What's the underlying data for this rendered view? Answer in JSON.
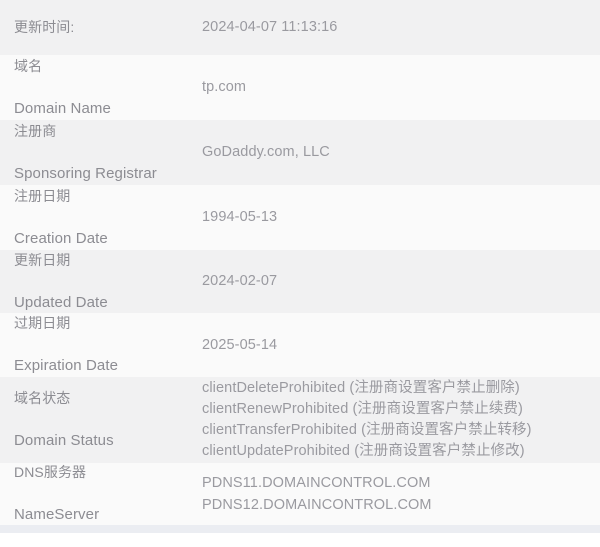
{
  "table": {
    "rows": [
      {
        "label_cn": "更新时间:",
        "label_en": "",
        "value": "2024-04-07 11:13:16",
        "name": "update-time"
      },
      {
        "label_cn": "域名",
        "label_en": "Domain Name",
        "value": "tp.com",
        "name": "domain-name"
      },
      {
        "label_cn": "注册商",
        "label_en": "Sponsoring Registrar",
        "value": "GoDaddy.com, LLC",
        "name": "sponsoring-registrar"
      },
      {
        "label_cn": "注册日期",
        "label_en": "Creation Date",
        "value": "1994-05-13",
        "name": "creation-date"
      },
      {
        "label_cn": "更新日期",
        "label_en": "Updated Date",
        "value": "2024-02-07",
        "name": "updated-date"
      },
      {
        "label_cn": "过期日期",
        "label_en": "Expiration Date",
        "value": "2025-05-14",
        "name": "expiration-date"
      },
      {
        "label_cn": "域名状态",
        "label_en": "Domain Status",
        "value": "clientDeleteProhibited (注册商设置客户禁止删除)\nclientRenewProhibited (注册商设置客户禁止续费)\nclientTransferProhibited (注册商设置客户禁止转移)\nclientUpdateProhibited (注册商设置客户禁止修改)",
        "name": "domain-status"
      },
      {
        "label_cn": "DNS服务器",
        "label_en": "NameServer",
        "value": "PDNS11.DOMAINCONTROL.COM\nPDNS12.DOMAINCONTROL.COM",
        "name": "name-server"
      }
    ]
  },
  "colors": {
    "stripe_light": "#f1f1f2",
    "stripe_lighter": "#fafafa",
    "label_text": "#8c8c92",
    "value_text": "#9a9aa0",
    "bottom_strip": "#ebedf2"
  }
}
